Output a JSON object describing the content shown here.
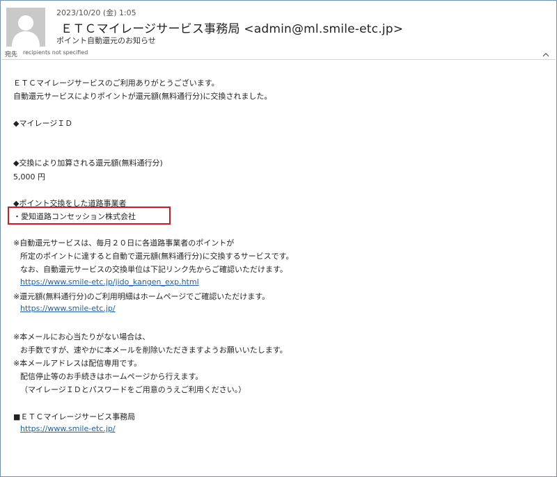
{
  "header": {
    "date": "2023/10/20 (金) 1:05",
    "sender": "ＥＴＣマイレージサービス事務局 <admin@ml.smile-etc.jp>",
    "subject": "ポイント自動還元のお知らせ",
    "to_label": "宛先",
    "to_value": "recipients not specified"
  },
  "body": {
    "greeting1": "ＥＴＣマイレージサービスのご利用ありがとうございます。",
    "greeting2": "自動還元サービスによりポイントが還元額(無料通行分)に交換されました。",
    "mileage_id_heading": "◆マイレージＩＤ",
    "amount_heading": "◆交換により加算される還元額(無料通行分)",
    "amount_value": "5,000 円",
    "operator_heading": "◆ポイント交換をした道路事業者",
    "operator_value": "・愛知道路コンセッション株式会社",
    "note1_a": "※自動還元サービスは、毎月２０日に各道路事業者のポイントが",
    "note1_b": "所定のポイントに達すると自動で還元額(無料通行分)に交換するサービスです。",
    "note1_c": "なお、自動還元サービスの交換単位は下記リンク先からご確認いただけます。",
    "link1": "https://www.smile-etc.jp/jido_kangen_exp.html",
    "note2_a": "※還元額(無料通行分)のご利用明細はホームページでご確認いただけます。",
    "link2": "https://www.smile-etc.jp/",
    "note3_a": "※本メールにお心当たりがない場合は、",
    "note3_b": "お手数ですが、速やかに本メールを削除いただきますようお願いいたします。",
    "note4_a": "※本メールアドレスは配信専用です。",
    "note4_b": "配信停止等のお手続きはホームページから行えます。",
    "note4_c": "（マイレージＩＤとパスワードをご用意のうえご利用ください。）",
    "signature": "■ＥＴＣマイレージサービス事務局",
    "link3": "https://www.smile-etc.jp/"
  },
  "colors": {
    "link": "#1a5fb4",
    "highlight": "#e0121b",
    "frame": "#6e8fb8"
  },
  "icons": {
    "avatar": "person-silhouette-icon",
    "collapse": "chevron-up-icon"
  }
}
